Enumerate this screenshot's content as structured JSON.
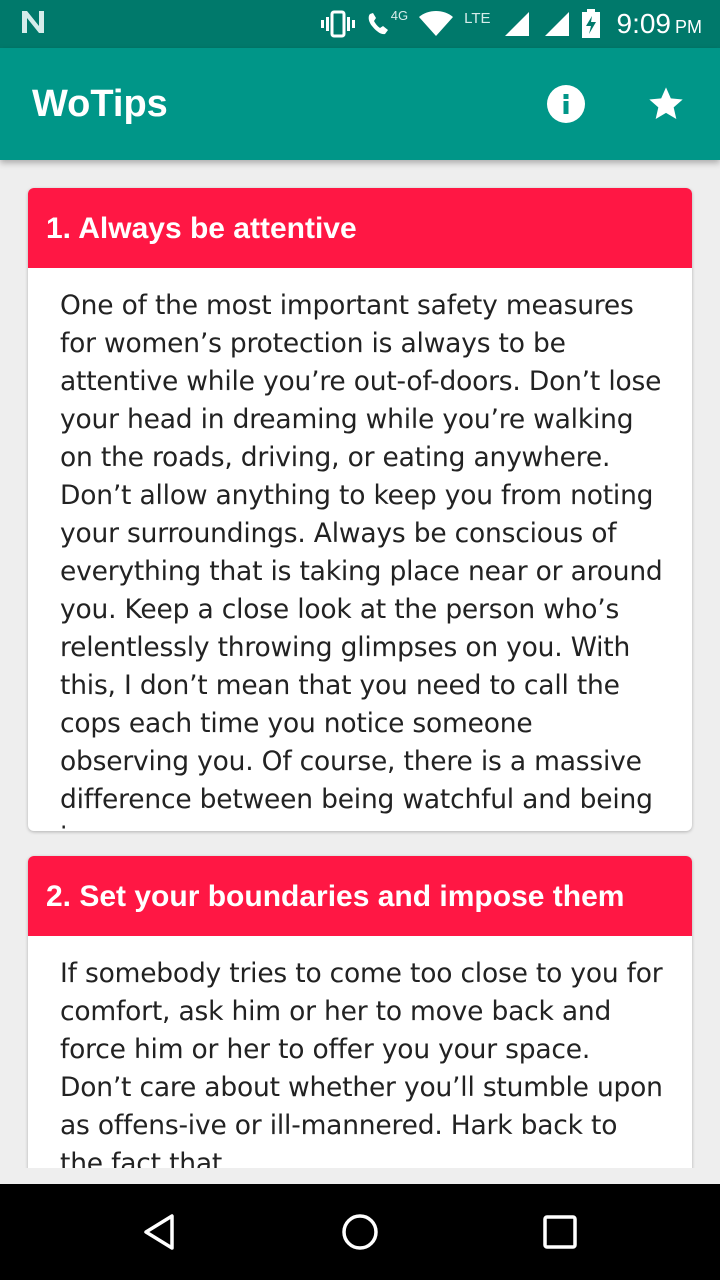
{
  "status_bar": {
    "network_badge": "4G",
    "network_type": "LTE",
    "time": "9:09",
    "ampm": "PM"
  },
  "app_bar": {
    "title": "WoTips",
    "actions": [
      "info-icon",
      "star-icon"
    ]
  },
  "tips": [
    {
      "title": "1. Always be attentive",
      "body": "One of the most important safety measures for women’s protection is always to be attentive while you’re out-of-doors. Don’t lose your head in dreaming while you’re walking on the roads, driving, or eating anywhere. Don’t allow anything to keep you from noting your surroundings. Always be conscious of everything that is taking place near or around you. Keep a close look at the person who’s relentlessly throwing glimpses on you. With this, I don’t mean that you need to call the cops each time you notice someone observing you. Of course, there is a massive difference between being watchful and being insecure."
    },
    {
      "title": "2. Set your boundaries and impose them",
      "body": "If somebody tries to come too close to you for comfort, ask him or her to move back and force him or her to offer you your space. Don’t care about whether you’ll stumble upon as offens-ive or ill-mannered. Hark back to the fact that"
    }
  ],
  "colors": {
    "status_bar": "#00796b",
    "app_bar": "#009688",
    "card_header": "#ff1744",
    "background": "#eeeeee"
  },
  "nav_bar": {
    "buttons": [
      "back-icon",
      "home-icon",
      "recents-icon"
    ]
  }
}
